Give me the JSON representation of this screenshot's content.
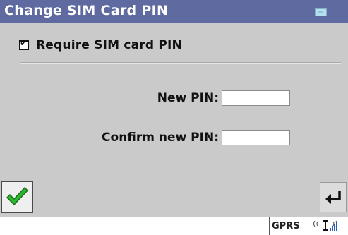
{
  "window": {
    "title": "Change SIM Card PIN"
  },
  "require_pin": {
    "label": "Require SIM card PIN",
    "checked": true
  },
  "form": {
    "new_pin_label": "New PIN:",
    "new_pin_value": "",
    "confirm_pin_label": "Confirm new PIN:",
    "confirm_pin_value": ""
  },
  "toolbar": {
    "ok_icon": "checkmark-icon",
    "back_icon": "back-arrow-icon"
  },
  "status_bar": {
    "network_type": "GPRS",
    "signal_icon": "signal-strength-icon"
  },
  "colors": {
    "titlebar": "#5e6aa0",
    "background": "#cacaca",
    "checkmark": "#2db82d"
  }
}
